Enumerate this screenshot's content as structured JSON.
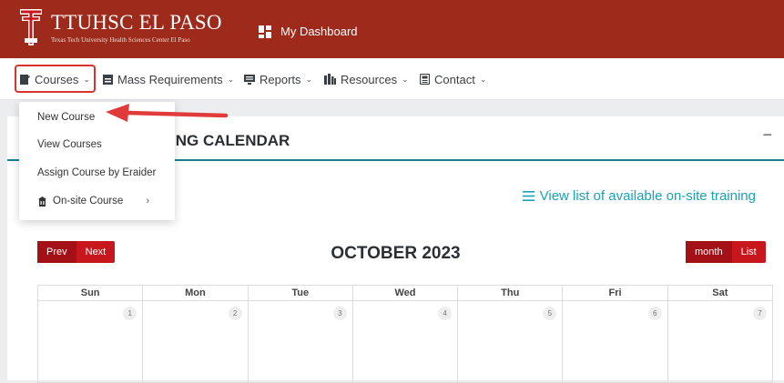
{
  "header": {
    "brand": "TTUHSC EL PASO",
    "brand_sub": "Texas Tech University Health Sciences Center El Paso",
    "dashboard": "My Dashboard",
    "colors": {
      "header_bg": "#9e2a1c",
      "accent_red": "#c8161d",
      "accent_teal": "#17a2b8"
    }
  },
  "nav": {
    "items": [
      {
        "label": "Courses",
        "icon": "clipboard-icon"
      },
      {
        "label": "Mass Requirements",
        "icon": "calendar-icon"
      },
      {
        "label": "Reports",
        "icon": "monitor-icon"
      },
      {
        "label": "Resources",
        "icon": "book-icon"
      },
      {
        "label": "Contact",
        "icon": "phone-icon"
      }
    ]
  },
  "dropdown": {
    "items": [
      {
        "label": "New Course"
      },
      {
        "label": "View Courses"
      },
      {
        "label": "Assign Course by Eraider"
      },
      {
        "label": "On-site Course",
        "icon": "building-icon",
        "has_submenu": true
      }
    ]
  },
  "panel": {
    "title": "ING CALENDAR",
    "collapse": "−",
    "view_list": "View list of available on-site training"
  },
  "calendar": {
    "prev": "Prev",
    "next": "Next",
    "month_title": "OCTOBER 2023",
    "month_btn": "month",
    "list_btn": "List",
    "days": [
      "Sun",
      "Mon",
      "Tue",
      "Wed",
      "Thu",
      "Fri",
      "Sat"
    ],
    "dates": [
      "1",
      "2",
      "3",
      "4",
      "5",
      "6",
      "7"
    ]
  }
}
